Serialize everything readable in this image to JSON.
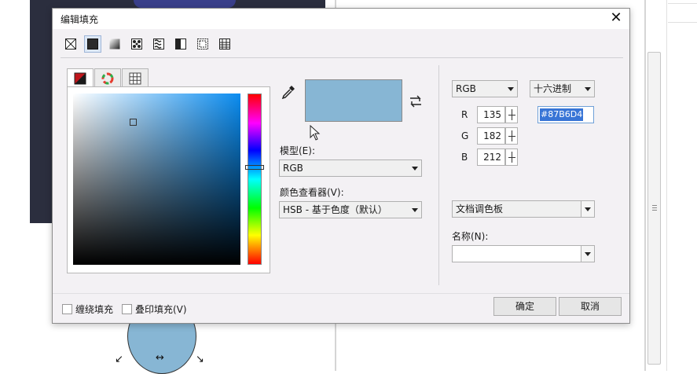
{
  "dialog": {
    "title": "编辑填充",
    "close_glyph": "✕",
    "fill_types": [
      "no-fill-icon",
      "uniform-fill-icon",
      "fountain-fill-icon",
      "vector-pattern-icon",
      "bitmap-pattern-icon",
      "two-color-pattern-icon",
      "texture-fill-icon",
      "postscript-fill-icon"
    ],
    "tabs": [
      "color-viewers-icon",
      "color-harmonies-icon",
      "color-palettes-icon"
    ]
  },
  "color": {
    "hex": "#87B6D4",
    "swatch_color": "#87b6d4"
  },
  "model": {
    "label": "模型(E):",
    "value": "RGB"
  },
  "viewer": {
    "label": "颜色查看器(V):",
    "value": "HSB - 基于色度（默认）"
  },
  "right": {
    "model_value": "RGB",
    "format_value": "十六进制",
    "channels": [
      {
        "label": "R",
        "value": "135"
      },
      {
        "label": "G",
        "value": "182"
      },
      {
        "label": "B",
        "value": "212"
      }
    ],
    "palette_value": "文档调色板",
    "name_label": "名称(N):",
    "name_value": ""
  },
  "bottom": {
    "wrap_fill": "缠绕填充",
    "overprint_fill": "叠印填充(V)",
    "ok": "确定",
    "cancel": "取消"
  }
}
